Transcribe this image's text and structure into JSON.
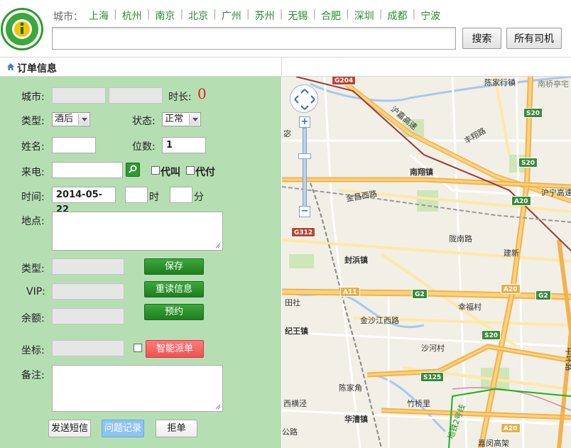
{
  "header": {
    "city_label": "城市：",
    "cities": [
      "上海",
      "杭州",
      "南京",
      "北京",
      "广州",
      "苏州",
      "无锡",
      "合肥",
      "深圳",
      "成都",
      "宁波"
    ],
    "search_value": "",
    "search_button": "搜索",
    "all_drivers_button": "所有司机"
  },
  "page_title": "订单信息",
  "form": {
    "city_label": "城市:",
    "duration_label": "时长:",
    "duration_value": "0",
    "type_label": "类型:",
    "type_value": "酒后",
    "status_label": "状态:",
    "status_value": "正常",
    "name_label": "姓名:",
    "seats_label": "位数:",
    "seats_value": "1",
    "phone_label": "来电:",
    "proxy_call_label": "代叫",
    "proxy_pay_label": "代付",
    "time_label": "时间:",
    "date_value": "2014-05-22",
    "hour_label": "时",
    "minute_label": "分",
    "address_label": "地点:",
    "type2_label": "类型:",
    "vip_label": "VIP:",
    "balance_label": "余额:",
    "save_button": "保存",
    "reload_button": "重读信息",
    "reserve_button": "预约",
    "coord_label": "坐标:",
    "smart_dispatch_button": "智能派单",
    "remark_label": "备注:",
    "send_sms_button": "发送短信",
    "issue_log_button": "问题记录",
    "reject_button": "拒单"
  },
  "map": {
    "labels": {
      "chenjiahang": "陈家行镇",
      "nanqiao": "南桥亭宅",
      "huning_expy": "沪嘉高速",
      "fengxiang_rd": "丰翔路",
      "nanxiang": "南翔镇",
      "jinchang_rd": "金昌西路",
      "hu_ning": "沪宁高速",
      "longnan_rd": "陇南路",
      "jianxin": "建新",
      "fengbang": "封浜镇",
      "tianjia": "田社",
      "xingfu": "幸福村",
      "jinshajiang": "金沙江西路",
      "jiwang": "纪王镇",
      "shahe": "沙河村",
      "chenjiajiao": "陈家角",
      "xiheng": "西横泾",
      "zhuqiao": "竹桥里",
      "huacao": "华漕镇",
      "ring": "中环路",
      "metro": "地铁2号线",
      "jiao": "嘉闵高架",
      "gong": "公路",
      "mi": "宓"
    },
    "shields": {
      "g204": "G204",
      "s20a": "S20",
      "s20b": "S20",
      "a20a": "A20",
      "g312": "G312",
      "a11": "A11",
      "g2a": "G2",
      "g2b": "G2",
      "a20b": "A20",
      "s20c": "S20",
      "s125": "S125",
      "a20c": "A20"
    }
  },
  "colors": {
    "panel_bg": "#b5dfb3",
    "accent_green": "#2a8a2a",
    "save_green": "#1d7f1d",
    "dispatch_red": "#ef5252",
    "issue_blue": "#8ec3f1",
    "duration_red": "#d22222"
  },
  "icons": [
    "logo-icon",
    "home-icon",
    "phone-search-icon",
    "map-pan-icon",
    "zoom-plus-icon",
    "zoom-minus-icon"
  ]
}
